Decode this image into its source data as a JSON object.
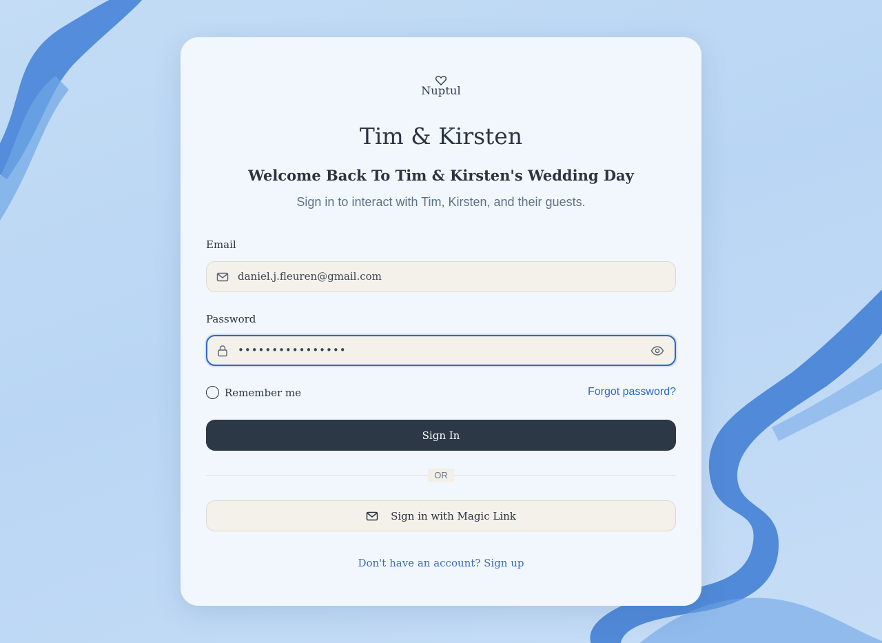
{
  "brand": {
    "name": "Nuptul"
  },
  "header": {
    "title": "Tim & Kirsten",
    "welcome": "Welcome Back To Tim & Kirsten's Wedding Day",
    "subtitle": "Sign in to interact with Tim, Kirsten, and their guests."
  },
  "form": {
    "email": {
      "label": "Email",
      "value": "daniel.j.fleuren@gmail.com",
      "icon": "mail-icon"
    },
    "password": {
      "label": "Password",
      "value": "••••••••••••••••",
      "icon": "lock-icon",
      "toggle_icon": "eye-icon"
    },
    "remember_label": "Remember me",
    "remember_checked": false,
    "forgot_label": "Forgot password?",
    "signin_label": "Sign In",
    "divider_label": "OR",
    "magic_link_label": "Sign in with Magic Link",
    "signup_label": "Don't have an account? Sign up"
  },
  "colors": {
    "primary_button": "#2c3845",
    "link": "#2f67c4",
    "focus_ring": "#2f67c4",
    "input_bg": "#f4f1ea",
    "card_bg": "#f2f7fd"
  }
}
